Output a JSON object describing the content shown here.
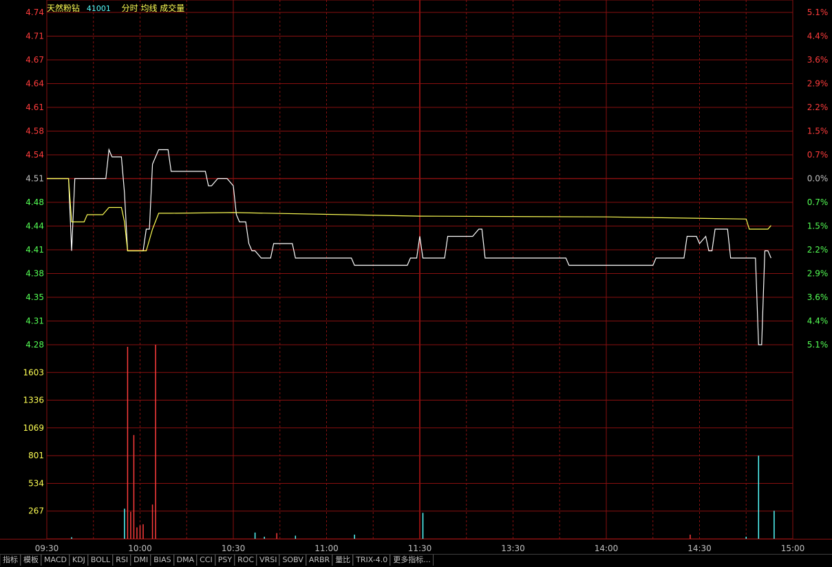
{
  "header": {
    "stock_name": "天然粉钻",
    "stock_code": "41001",
    "labels": "分时 均线 成交量"
  },
  "tabs": [
    "指标",
    "模板",
    "MACD",
    "KDJ",
    "BOLL",
    "RSI",
    "DMI",
    "BIAS",
    "DMA",
    "CCI",
    "PSY",
    "ROC",
    "VRSI",
    "SOBV",
    "ARBR",
    "量比",
    "TRIX-4.0",
    "更多指标..."
  ],
  "colors": {
    "up": "#ff3c3c",
    "down": "#54ff54",
    "grid": "#8a1010",
    "price_line": "#ffffff",
    "avg_line": "#ffff54",
    "volume_up": "#ff3c3c",
    "volume_down": "#54ffff",
    "vol_axis": "#ffff54"
  },
  "chart_data": [
    {
      "type": "line",
      "title": "分时",
      "prev_close": 4.51,
      "price_ticks": [
        "4.74",
        "4.71",
        "4.67",
        "4.64",
        "4.61",
        "4.58",
        "4.54",
        "4.51",
        "4.48",
        "4.44",
        "4.41",
        "4.38",
        "4.35",
        "4.31",
        "4.28"
      ],
      "pct_ticks": [
        "5.1%",
        "4.4%",
        "3.6%",
        "2.9%",
        "2.2%",
        "1.5%",
        "0.7%",
        "0.0%",
        "0.7%",
        "1.5%",
        "2.2%",
        "2.9%",
        "3.6%",
        "4.4%",
        "5.1%"
      ],
      "ylim": [
        4.28,
        4.74
      ],
      "x_ticks": [
        "09:30",
        "10:00",
        "10:30",
        "11:00",
        "11:30",
        "13:30",
        "14:00",
        "14:30",
        "15:00"
      ],
      "x_range_minutes": [
        0,
        240
      ],
      "series": [
        {
          "name": "分时",
          "points": [
            [
              0,
              4.51
            ],
            [
              7,
              4.51
            ],
            [
              8,
              4.41
            ],
            [
              9,
              4.51
            ],
            [
              19,
              4.51
            ],
            [
              20,
              4.55
            ],
            [
              21,
              4.54
            ],
            [
              24,
              4.54
            ],
            [
              25,
              4.49
            ],
            [
              26,
              4.41
            ],
            [
              31,
              4.41
            ],
            [
              32,
              4.44
            ],
            [
              33,
              4.44
            ],
            [
              34,
              4.53
            ],
            [
              36,
              4.55
            ],
            [
              39,
              4.55
            ],
            [
              40,
              4.52
            ],
            [
              51,
              4.52
            ],
            [
              52,
              4.5
            ],
            [
              53,
              4.5
            ],
            [
              55,
              4.51
            ],
            [
              58,
              4.51
            ],
            [
              60,
              4.5
            ],
            [
              61,
              4.46
            ],
            [
              62,
              4.45
            ],
            [
              64,
              4.45
            ],
            [
              65,
              4.42
            ],
            [
              66,
              4.41
            ],
            [
              67,
              4.41
            ],
            [
              69,
              4.4
            ],
            [
              72,
              4.4
            ],
            [
              73,
              4.42
            ],
            [
              79,
              4.42
            ],
            [
              80,
              4.4
            ],
            [
              98,
              4.4
            ],
            [
              99,
              4.39
            ],
            [
              116,
              4.39
            ],
            [
              117,
              4.4
            ],
            [
              119,
              4.4
            ],
            [
              120,
              4.43
            ],
            [
              121,
              4.4
            ],
            [
              128,
              4.4
            ],
            [
              129,
              4.43
            ],
            [
              137,
              4.43
            ],
            [
              139,
              4.44
            ],
            [
              140,
              4.44
            ],
            [
              141,
              4.4
            ],
            [
              167,
              4.4
            ],
            [
              168,
              4.39
            ],
            [
              195,
              4.39
            ],
            [
              196,
              4.4
            ],
            [
              205,
              4.4
            ],
            [
              206,
              4.43
            ],
            [
              209,
              4.43
            ],
            [
              210,
              4.42
            ],
            [
              212,
              4.43
            ],
            [
              213,
              4.41
            ],
            [
              214,
              4.41
            ],
            [
              215,
              4.44
            ],
            [
              219,
              4.44
            ],
            [
              220,
              4.4
            ],
            [
              228,
              4.4
            ],
            [
              229,
              4.28
            ],
            [
              230,
              4.28
            ],
            [
              231,
              4.41
            ],
            [
              232,
              4.41
            ],
            [
              233,
              4.4
            ]
          ]
        },
        {
          "name": "均线",
          "points": [
            [
              0,
              4.51
            ],
            [
              7,
              4.51
            ],
            [
              8,
              4.45
            ],
            [
              12,
              4.45
            ],
            [
              13,
              4.46
            ],
            [
              18,
              4.46
            ],
            [
              20,
              4.47
            ],
            [
              24,
              4.47
            ],
            [
              25,
              4.45
            ],
            [
              26,
              4.41
            ],
            [
              32,
              4.41
            ],
            [
              34,
              4.44
            ],
            [
              36,
              4.462
            ],
            [
              40,
              4.462
            ],
            [
              60,
              4.463
            ],
            [
              120,
              4.458
            ],
            [
              180,
              4.457
            ],
            [
              225,
              4.454
            ],
            [
              226,
              4.44
            ],
            [
              232,
              4.44
            ],
            [
              233,
              4.445
            ]
          ]
        }
      ]
    },
    {
      "type": "bar",
      "title": "成交量",
      "vol_ticks": [
        "1603",
        "1336",
        "1069",
        "801",
        "534",
        "267"
      ],
      "ylim": [
        0,
        1870
      ],
      "bars": [
        [
          8,
          15,
          "down"
        ],
        [
          25,
          290,
          "down"
        ],
        [
          26,
          1850,
          "up"
        ],
        [
          27,
          260,
          "up"
        ],
        [
          28,
          1000,
          "up"
        ],
        [
          29,
          110,
          "up"
        ],
        [
          30,
          130,
          "up"
        ],
        [
          31,
          140,
          "up"
        ],
        [
          34,
          330,
          "up"
        ],
        [
          35,
          1870,
          "up"
        ],
        [
          67,
          60,
          "down"
        ],
        [
          70,
          20,
          "down"
        ],
        [
          74,
          55,
          "up"
        ],
        [
          80,
          30,
          "down"
        ],
        [
          99,
          40,
          "down"
        ],
        [
          121,
          250,
          "down"
        ],
        [
          207,
          40,
          "up"
        ],
        [
          225,
          20,
          "down"
        ],
        [
          229,
          801,
          "down"
        ],
        [
          234,
          270,
          "down"
        ]
      ]
    }
  ]
}
